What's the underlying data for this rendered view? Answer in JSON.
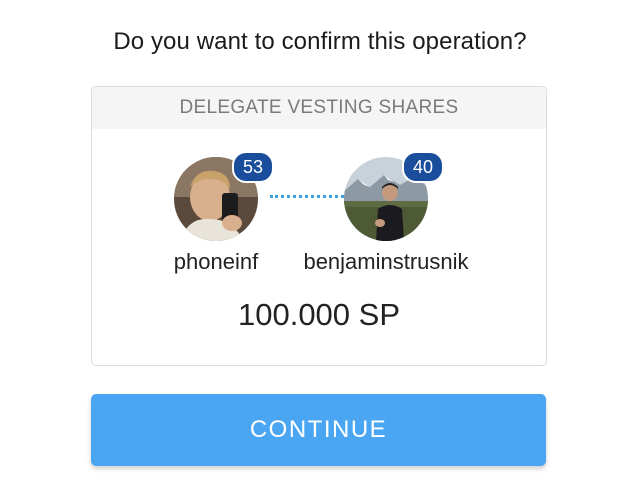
{
  "dialog": {
    "question": "Do you want to confirm this operation?",
    "operation_title": "DELEGATE VESTING SHARES",
    "from": {
      "username": "phoneinf",
      "reputation": "53"
    },
    "to": {
      "username": "benjaminstrusnik",
      "reputation": "40"
    },
    "amount": "100.000 SP",
    "continue_label": "CONTINUE"
  },
  "colors": {
    "accent": "#4aa6f2",
    "badge": "#1a4d9c",
    "connector": "#3ba4e0",
    "header_bg": "#f5f5f5"
  }
}
